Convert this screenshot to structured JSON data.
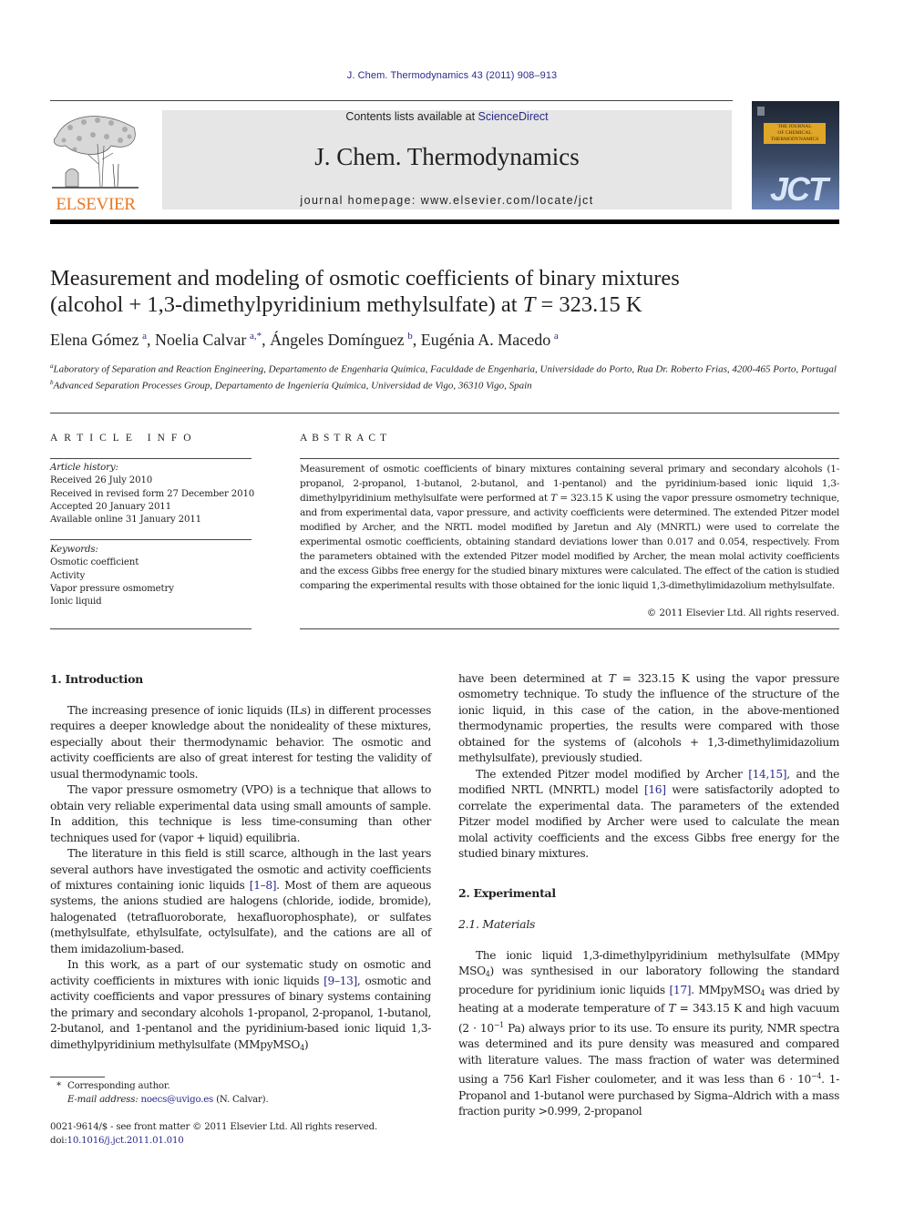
{
  "header": {
    "journal_ref": "J. Chem. Thermodynamics 43 (2011) 908–913",
    "publisher_logo_text": "ELSEVIER",
    "contents_prefix": "Contents lists available at ",
    "contents_link": "ScienceDirect",
    "journal_title": "J. Chem. Thermodynamics",
    "homepage": "journal homepage: www.elsevier.com/locate/jct",
    "cover": {
      "title_lines": [
        "THE JOURNAL",
        "OF CHEMICAL",
        "THERMODYNAMICS"
      ],
      "abbrev": "JCT"
    },
    "colors": {
      "link": "#2a2a8c",
      "elsevier_orange": "#e87722",
      "masthead_bg": "#e6e6e6"
    }
  },
  "article": {
    "title_line1": "Measurement and modeling of osmotic coefficients of binary mixtures",
    "title_line2_pre": "(alcohol + 1,3-dimethylpyridinium methylsulfate) at ",
    "title_line2_var": "T",
    "title_line2_post": " = 323.15 K",
    "authors": [
      {
        "name": "Elena Gómez",
        "sup": "a",
        "sep": ", "
      },
      {
        "name": "Noelia Calvar",
        "sup": "a,*",
        "sep": ", "
      },
      {
        "name": "Ángeles Domínguez",
        "sup": "b",
        "sep": ", "
      },
      {
        "name": "Eugénia A. Macedo",
        "sup": "a",
        "sep": ""
      }
    ],
    "affiliations": [
      {
        "mark": "a",
        "text": "Laboratory of Separation and Reaction Engineering, Departamento de Engenharia Química, Faculdade de Engenharia, Universidade do Porto, Rua Dr. Roberto Frias, 4200-465 Porto, Portugal"
      },
      {
        "mark": "b",
        "text": "Advanced Separation Processes Group, Departamento de Ingeniería Química, Universidad de Vigo, 36310 Vigo, Spain"
      }
    ]
  },
  "article_info": {
    "heading": "ARTICLE INFO",
    "history_label": "Article history:",
    "history": [
      "Received 26 July 2010",
      "Received in revised form 27 December 2010",
      "Accepted 20 January 2011",
      "Available online 31 January 2011"
    ],
    "keywords_label": "Keywords:",
    "keywords": [
      "Osmotic coefficient",
      "Activity",
      "Vapor pressure osmometry",
      "Ionic liquid"
    ]
  },
  "abstract": {
    "heading": "ABSTRACT",
    "text_pre": "Measurement of osmotic coefficients of binary mixtures containing several primary and secondary alcohols (1-propanol, 2-propanol, 1-butanol, 2-butanol, and 1-pentanol) and the pyridinium-based ionic liquid 1,3-dimethylpyridinium methylsulfate were performed at ",
    "text_var": "T",
    "text_post": " = 323.15 K using the vapor pressure osmometry technique, and from experimental data, vapor pressure, and activity coefficients were determined. The extended Pitzer model modified by Archer, and the NRTL model modified by Jaretun and Aly (MNRTL) were used to correlate the experimental osmotic coefficients, obtaining standard deviations lower than 0.017 and 0.054, respectively. From the parameters obtained with the extended Pitzer model modified by Archer, the mean molal activity coefficients and the excess Gibbs free energy for the studied binary mixtures were calculated. The effect of the cation is studied comparing the experimental results with those obtained for the ionic liquid 1,3-dimethylimidazolium methylsulfate.",
    "copyright": "© 2011 Elsevier Ltd. All rights reserved."
  },
  "body": {
    "intro_heading": "1. Introduction",
    "intro_p1": "The increasing presence of ionic liquids (ILs) in different processes requires a deeper knowledge about the nonideality of these mixtures, especially about their thermodynamic behavior. The osmotic and activity coefficients are also of great interest for testing the validity of usual thermodynamic tools.",
    "intro_p2": "The vapor pressure osmometry (VPO) is a technique that allows to obtain very reliable experimental data using small amounts of sample. In addition, this technique is less time-consuming than other techniques used for (vapor + liquid) equilibria.",
    "intro_p3_a": "The literature in this field is still scarce, although in the last years several authors have investigated the osmotic and activity coefficients of mixtures containing ionic liquids ",
    "intro_p3_ref": "[1–8]",
    "intro_p3_b": ". Most of them are aqueous systems, the anions studied are halogens (chloride, iodide, bromide), halogenated (tetrafluoroborate, hexafluorophosphate), or sulfates (methylsulfate, ethylsulfate, octylsulfate), and the cations are all of them imidazolium-based.",
    "intro_p4_a": "In this work, as a part of our systematic study on osmotic and activity coefficients in mixtures with ionic liquids ",
    "intro_p4_ref": "[9–13]",
    "intro_p4_b": ", osmotic and activity coefficients and vapor pressures of binary systems containing the primary and secondary alcohols 1-propanol, 2-propanol, 1-butanol, 2-butanol, and 1-pentanol and the pyridinium-based ionic liquid 1,3-dimethylpyridinium methylsulfate (MMpyMSO",
    "intro_p4_sub": "4",
    "intro_p4_c": ")",
    "right_p1_a": "have been determined at ",
    "right_p1_var": "T",
    "right_p1_b": " = 323.15 K using the vapor pressure osmometry technique. To study the influence of the structure of the ionic liquid, in this case of the cation, in the above-mentioned thermodynamic properties, the results were compared with those obtained for the systems of (alcohols + 1,3-dimethylimidazolium methylsulfate), previously studied.",
    "right_p2_a": "The extended Pitzer model modified by Archer ",
    "right_p2_ref1": "[14,15]",
    "right_p2_b": ", and the modified NRTL (MNRTL) model ",
    "right_p2_ref2": "[16]",
    "right_p2_c": " were satisfactorily adopted to correlate the experimental data. The parameters of the extended Pitzer model modified by Archer were used to calculate the mean molal activity coefficients and the excess Gibbs free energy for the studied binary mixtures.",
    "exp_heading": "2. Experimental",
    "materials_heading": "2.1. Materials",
    "mat_a": "The ionic liquid 1,3-dimethylpyridinium methylsulfate (MMpy MSO",
    "mat_sub1": "4",
    "mat_b": ") was synthesised in our laboratory following the standard procedure for pyridinium ionic liquids ",
    "mat_ref": "[17]",
    "mat_c": ". MMpyMSO",
    "mat_sub2": "4",
    "mat_d": " was dried by heating at a moderate temperature of ",
    "mat_var": "T",
    "mat_e": " = 343.15 K and high vacuum (2 · 10",
    "mat_sup1": "−1",
    "mat_f": " Pa) always prior to its use. To ensure its purity, NMR spectra was determined and its pure density was measured and compared with literature values. The mass fraction of water was determined using a 756 Karl Fisher coulometer, and it was less than 6 · 10",
    "mat_sup2": "−4",
    "mat_g": ". 1-Propanol and 1-butanol were purchased by Sigma–Aldrich with a mass fraction purity >0.999, 2-propanol"
  },
  "footnotes": {
    "star": "*",
    "corresponding": "Corresponding author.",
    "email_label": "E-mail address: ",
    "email": "noecs@uvigo.es",
    "email_suffix": " (N. Calvar).",
    "issn_line": "0021-9614/$ - see front matter © 2011 Elsevier Ltd. All rights reserved.",
    "doi_prefix": "doi:",
    "doi": "10.1016/j.jct.2011.01.010"
  }
}
